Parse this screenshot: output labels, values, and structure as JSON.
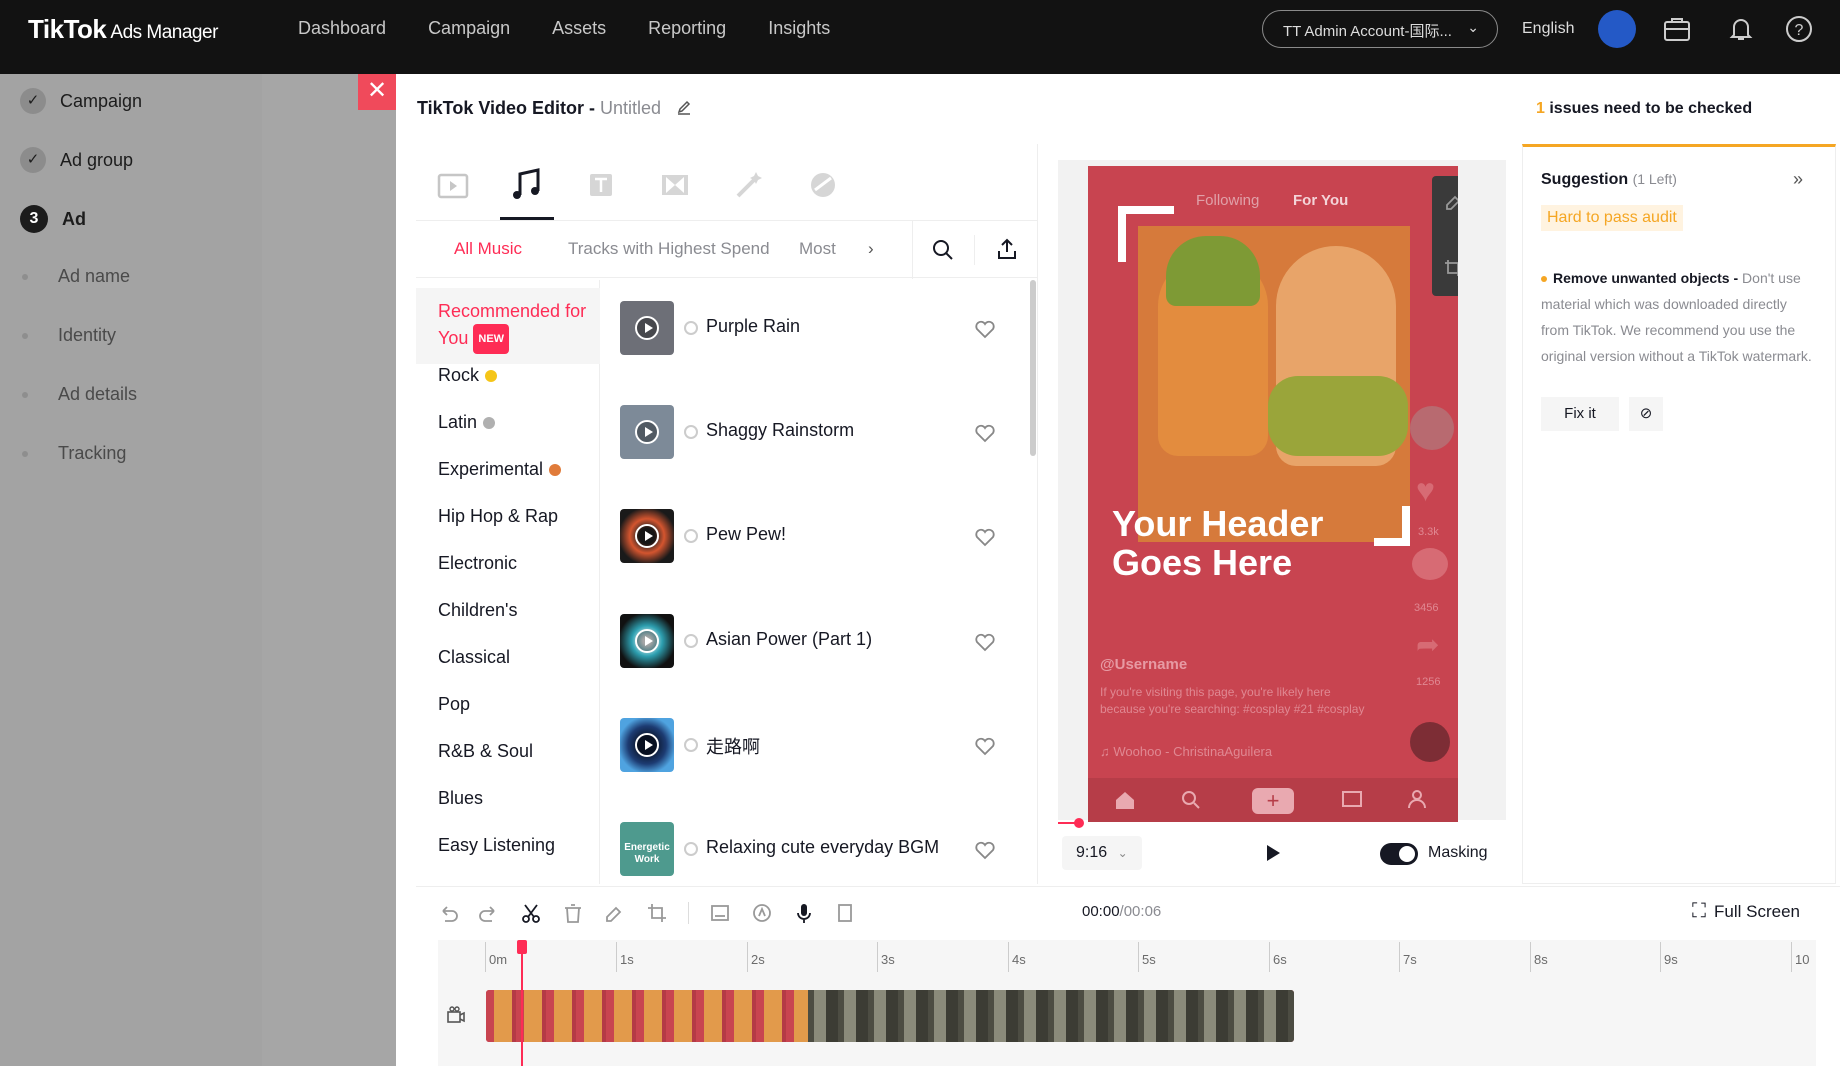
{
  "app": {
    "brand": "TikTok",
    "brand_sub": "Ads Manager"
  },
  "nav": [
    "Dashboard",
    "Campaign",
    "Assets",
    "Reporting",
    "Insights"
  ],
  "account": "TT Admin Account-国际...",
  "language": "English",
  "sidebar": {
    "steps": [
      {
        "label": "Campaign",
        "state": "done"
      },
      {
        "label": "Ad group",
        "state": "done"
      },
      {
        "label": "Ad",
        "state": "current",
        "number": "3"
      }
    ],
    "substeps": [
      "Ad name",
      "Identity",
      "Ad details",
      "Tracking"
    ]
  },
  "editor": {
    "title": "TikTok Video Editor - ",
    "untitled": "Untitled"
  },
  "issues": {
    "count": "1",
    "text": " issues need to be checked"
  },
  "music": {
    "filters": [
      "All Music",
      "Tracks with Highest Spend",
      "Most"
    ],
    "genres": [
      {
        "label": "Recommended for You",
        "badge": "NEW",
        "selected": true
      },
      {
        "label": "Rock",
        "medal": "#f5c518"
      },
      {
        "label": "Latin",
        "medal": "#b0b0b0"
      },
      {
        "label": "Experimental",
        "medal": "#e07b3a"
      },
      {
        "label": "Hip Hop & Rap"
      },
      {
        "label": "Electronic"
      },
      {
        "label": "Children's"
      },
      {
        "label": "Classical"
      },
      {
        "label": "Pop"
      },
      {
        "label": "R&B & Soul"
      },
      {
        "label": "Blues"
      },
      {
        "label": "Easy Listening"
      }
    ],
    "tracks": [
      {
        "name": "Purple Rain",
        "color": "#6d6f77"
      },
      {
        "name": "Shaggy Rainstorm",
        "color": "#7d8a98"
      },
      {
        "name": "Pew Pew!",
        "color": "#d4552f"
      },
      {
        "name": "Asian Power (Part 1)",
        "color": "#2d9fb0"
      },
      {
        "name": "走路啊",
        "color": "#1d3c73"
      },
      {
        "name": "Relaxing cute everyday BGM",
        "color": "#4e9a8e",
        "thumb_text": "Energetic Work"
      }
    ]
  },
  "preview": {
    "feed_tabs": [
      "Following",
      "For You"
    ],
    "header_text": "Your Header Goes Here",
    "username": "@Username",
    "caption": "If you're visiting this page, you're likely here because you're searching: #cosplay #21 #cosplay",
    "sound": "Woohoo - ChristinaAguilera",
    "counts": [
      "3.3k",
      "3456",
      "1256"
    ],
    "ratio": "9:16",
    "masking_label": "Masking",
    "masking_on": true
  },
  "suggestion": {
    "title": "Suggestion",
    "left": "(1 Left)",
    "tag": "Hard to pass audit",
    "item_title": "Remove unwanted objects - ",
    "item_text": "Don't use material which was downloaded directly from TikTok. We recommend you use the original version without a TikTok watermark.",
    "fix_label": "Fix it"
  },
  "timeline": {
    "time_current": "00:00",
    "time_total": "/00:06",
    "fullscreen": "Full Screen",
    "ticks": [
      "0m",
      "1s",
      "2s",
      "3s",
      "4s",
      "5s",
      "6s",
      "7s",
      "8s",
      "9s",
      "10"
    ]
  },
  "colors": {
    "accent": "#fe2c55",
    "warning": "#f5a623",
    "topbar": "#121212",
    "phone_bg": "#c84450"
  }
}
